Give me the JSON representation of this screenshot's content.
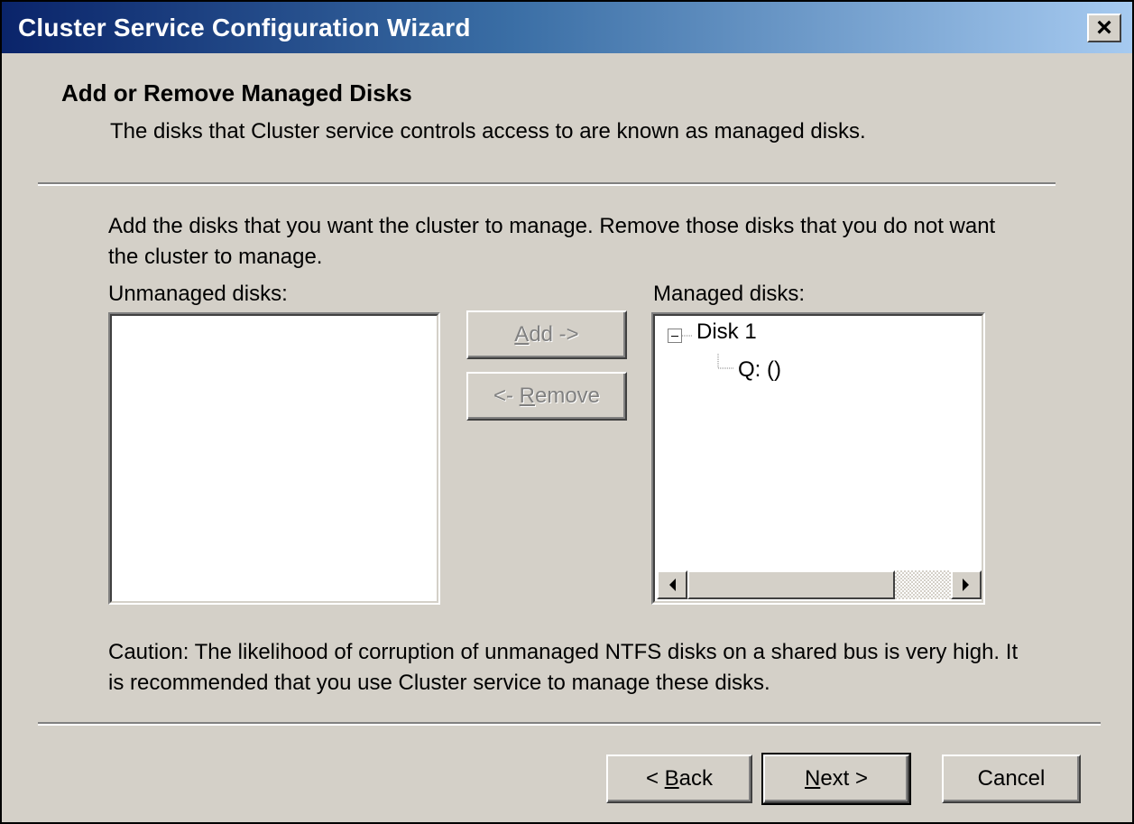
{
  "window": {
    "title": "Cluster Service Configuration Wizard",
    "close_label": "×"
  },
  "header": {
    "title": "Add or Remove Managed Disks",
    "subtitle": "The disks that Cluster service controls access to are known as managed disks."
  },
  "instructions": "Add the disks that you want the cluster to manage. Remove those disks that you do not want the cluster to manage.",
  "unmanaged": {
    "label": "Unmanaged disks:",
    "items": []
  },
  "managed": {
    "label": "Managed disks:",
    "tree": [
      {
        "label": "Disk 1",
        "expanded": true,
        "children": [
          {
            "label": "Q: ()"
          }
        ]
      }
    ]
  },
  "buttons": {
    "add": {
      "pre": "",
      "accel": "A",
      "post": "dd ->",
      "enabled": false
    },
    "remove": {
      "pre": "<- ",
      "accel": "R",
      "post": "emove",
      "enabled": false
    },
    "back": {
      "pre": "< ",
      "accel": "B",
      "post": "ack"
    },
    "next": {
      "pre": "",
      "accel": "N",
      "post": "ext >"
    },
    "cancel": "Cancel"
  },
  "scrollbar_icons": {
    "left": "arrow-left-icon",
    "right": "arrow-right-icon"
  },
  "caution": "Caution: The likelihood of corruption of unmanaged NTFS disks on a shared bus is very high. It is recommended that you use Cluster service to manage these disks.",
  "colors": {
    "face": "#d4d0c8",
    "title_start": "#0a246a",
    "title_end": "#a6caf0"
  }
}
